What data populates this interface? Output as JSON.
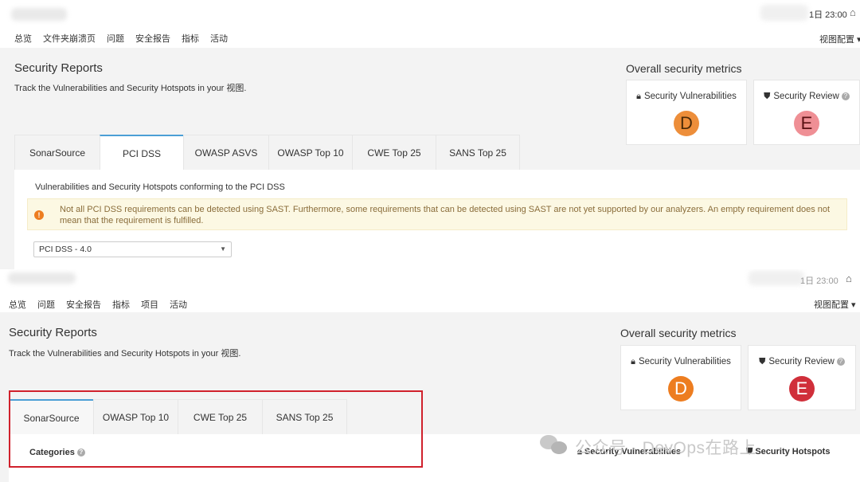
{
  "top": {
    "time": "1日 23:00",
    "nav": [
      "总览",
      "文件夹崩溃页",
      "问题",
      "安全报告",
      "指标",
      "活动"
    ],
    "active_nav": 3,
    "view_config": "视图配置",
    "title": "Security Reports",
    "description": "Track the Vulnerabilities and Security Hotspots in your 视图.",
    "metrics_title": "Overall security metrics",
    "metric_vuln": "Security Vulnerabilities",
    "metric_review": "Security Review",
    "grade_vuln": "D",
    "grade_review": "E",
    "tabs": [
      "SonarSource",
      "PCI DSS",
      "OWASP ASVS",
      "OWASP Top 10",
      "CWE Top 25",
      "SANS Top 25"
    ],
    "active_tab": 1,
    "conforming_text": "Vulnerabilities and Security Hotspots conforming to the PCI DSS",
    "warning": "Not all PCI DSS requirements can be detected using SAST. Furthermore, some requirements that can be detected using SAST are not yet supported by our analyzers. An empty requirement does not mean that the requirement is fulfilled.",
    "select_value": "PCI DSS - 4.0"
  },
  "bottom": {
    "time": "1日 23:00",
    "nav": [
      "总览",
      "问题",
      "安全报告",
      "指标",
      "项目",
      "活动"
    ],
    "active_nav": 2,
    "view_config": "视图配置",
    "title": "Security Reports",
    "description": "Track the Vulnerabilities and Security Hotspots in your 视图.",
    "metrics_title": "Overall security metrics",
    "metric_vuln": "Security Vulnerabilities",
    "metric_review": "Security Review",
    "grade_vuln": "D",
    "grade_review": "E",
    "tabs": [
      "SonarSource",
      "OWASP Top 10",
      "CWE Top 25",
      "SANS Top 25"
    ],
    "active_tab": 0,
    "categories": "Categories",
    "col_vuln": "Security Vulnerabilities",
    "col_hotspots": "Security Hotspots"
  },
  "watermark": "公众号 · DevOps在路上",
  "colors": {
    "grade_d_top": "#ed8e3a",
    "grade_e_top": "#ef8f95",
    "grade_d_bottom": "#ed7d20",
    "grade_e_bottom": "#d02f3a",
    "highlight_box": "#d0212c",
    "tab_active": "#4b9fd5"
  }
}
